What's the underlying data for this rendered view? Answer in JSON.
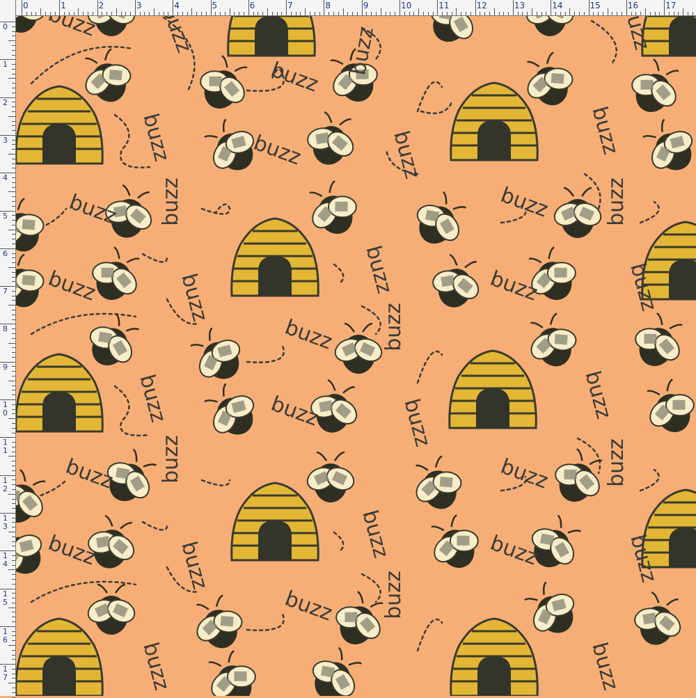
{
  "buzz_text": "buzz",
  "ruler": {
    "units": [
      "0",
      "1",
      "2",
      "3",
      "4",
      "5",
      "6",
      "7",
      "8",
      "9",
      "10",
      "11",
      "12",
      "13",
      "14",
      "15",
      "16",
      "17"
    ]
  },
  "colors": {
    "background": "#f6ae76",
    "hive": "#e3b735",
    "outline": "#3a3a2c",
    "bee_body": "#2e2f22",
    "wing": "#f8edc8",
    "wing_shade": "#8b8a78",
    "ruler_bg": "#f4f4f4",
    "ruler_text": "#1a3a8a"
  },
  "motif_icons": [
    "beehive-icon",
    "bee-icon",
    "buzz-label",
    "dashed-flight-path"
  ]
}
